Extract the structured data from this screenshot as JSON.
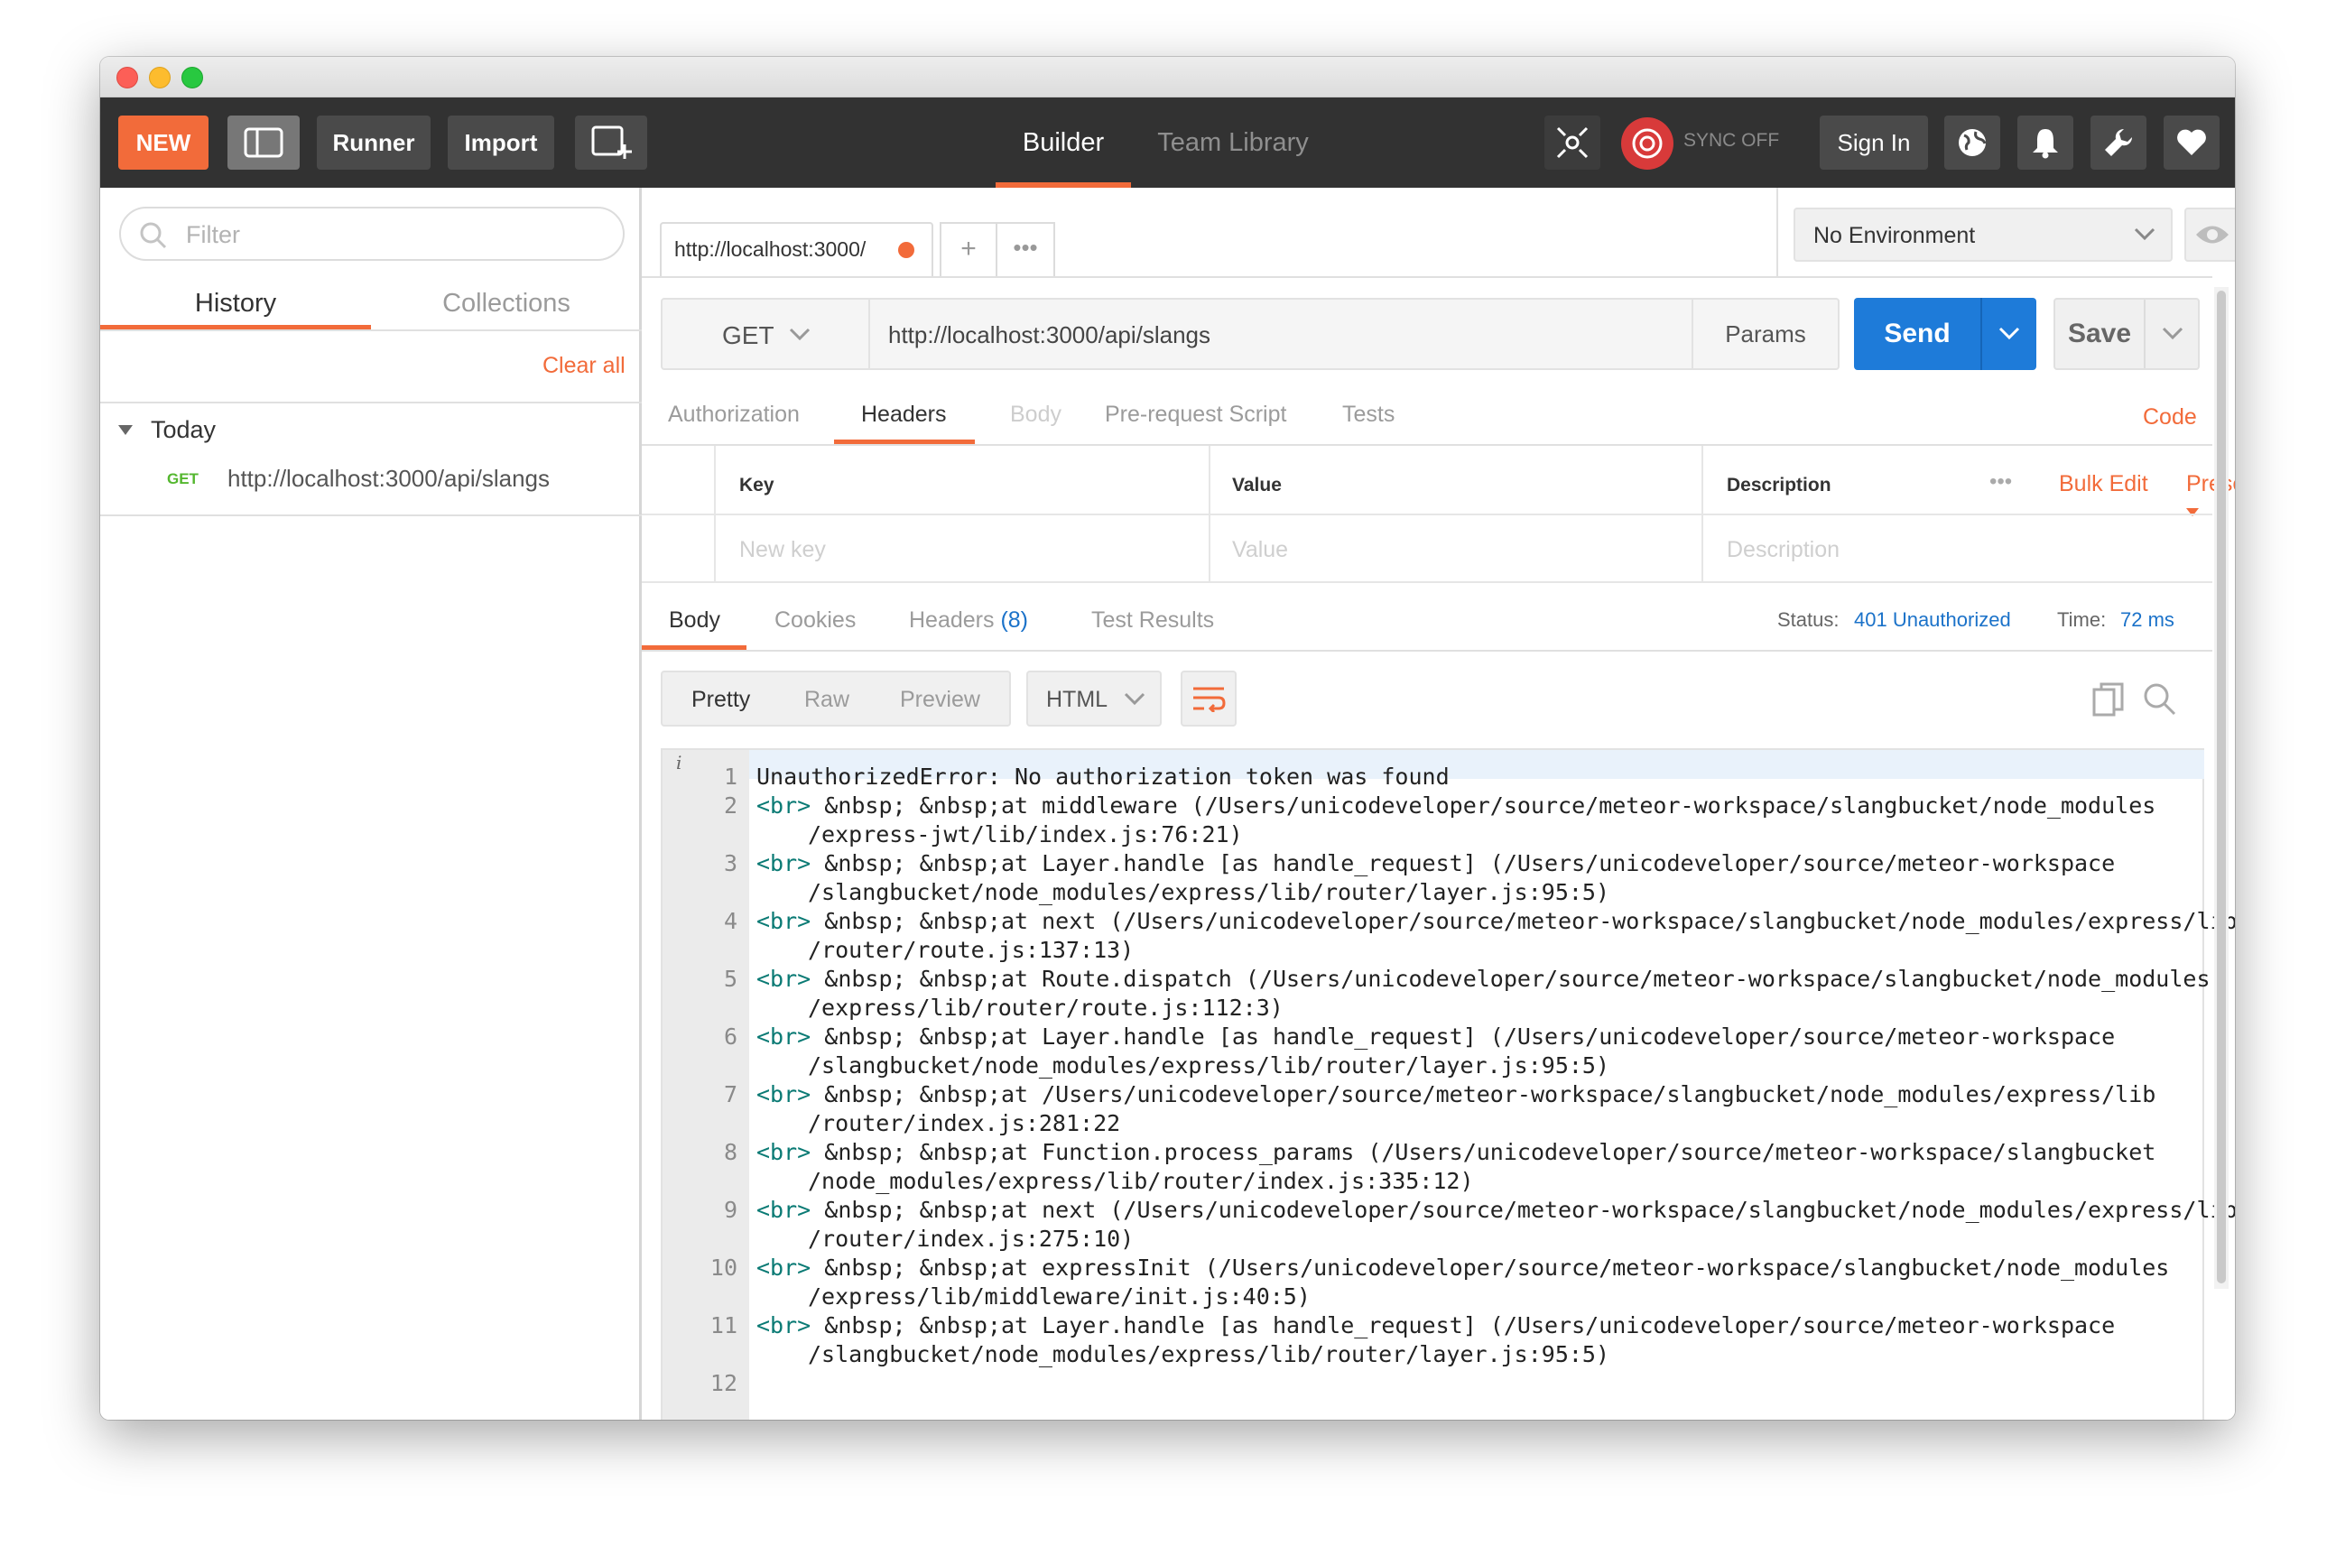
{
  "topbar": {
    "new_label": "NEW",
    "runner_label": "Runner",
    "import_label": "Import",
    "builder_tab": "Builder",
    "team_library_tab": "Team Library",
    "sync_label": "SYNC OFF",
    "signin_label": "Sign In"
  },
  "sidebar": {
    "filter_placeholder": "Filter",
    "tabs": [
      "History",
      "Collections"
    ],
    "clear_all": "Clear all",
    "group": "Today",
    "items": [
      {
        "method": "GET",
        "url": "http://localhost:3000/api/slangs"
      }
    ]
  },
  "request_tab": {
    "url": "http://localhost:3000/"
  },
  "environment": {
    "selected": "No Environment"
  },
  "request": {
    "method": "GET",
    "url": "http://localhost:3000/api/slangs",
    "params_label": "Params",
    "send_label": "Send",
    "save_label": "Save",
    "tabs": [
      "Authorization",
      "Headers",
      "Body",
      "Pre-request Script",
      "Tests"
    ],
    "code_label": "Code"
  },
  "headers_table": {
    "columns": [
      "Key",
      "Value",
      "Description"
    ],
    "bulk_edit": "Bulk Edit",
    "presets": "Presets",
    "placeholders": {
      "key": "New key",
      "value": "Value",
      "description": "Description"
    }
  },
  "response": {
    "tabs": [
      "Body",
      "Cookies",
      "Headers",
      "Test Results"
    ],
    "headers_count": "(8)",
    "status_label": "Status:",
    "status_value": "401 Unauthorized",
    "time_label": "Time:",
    "time_value": "72 ms",
    "view_modes": [
      "Pretty",
      "Raw",
      "Preview"
    ],
    "format": "HTML",
    "lines": [
      {
        "num": "1",
        "text": [
          "UnauthorizedError: No authorization token was found"
        ]
      },
      {
        "num": "2",
        "text": [
          "&nbsp; &nbsp;at middleware (/Users/unicodeveloper/source/meteor-workspace/slangbucket/node_modules",
          "/express-jwt/lib/index.js:76:21)"
        ]
      },
      {
        "num": "3",
        "text": [
          "&nbsp; &nbsp;at Layer.handle [as handle_request] (/Users/unicodeveloper/source/meteor-workspace",
          "/slangbucket/node_modules/express/lib/router/layer.js:95:5)"
        ]
      },
      {
        "num": "4",
        "text": [
          "&nbsp; &nbsp;at next (/Users/unicodeveloper/source/meteor-workspace/slangbucket/node_modules/express/lib",
          "/router/route.js:137:13)"
        ]
      },
      {
        "num": "5",
        "text": [
          "&nbsp; &nbsp;at Route.dispatch (/Users/unicodeveloper/source/meteor-workspace/slangbucket/node_modules",
          "/express/lib/router/route.js:112:3)"
        ]
      },
      {
        "num": "6",
        "text": [
          "&nbsp; &nbsp;at Layer.handle [as handle_request] (/Users/unicodeveloper/source/meteor-workspace",
          "/slangbucket/node_modules/express/lib/router/layer.js:95:5)"
        ]
      },
      {
        "num": "7",
        "text": [
          "&nbsp; &nbsp;at /Users/unicodeveloper/source/meteor-workspace/slangbucket/node_modules/express/lib",
          "/router/index.js:281:22"
        ]
      },
      {
        "num": "8",
        "text": [
          "&nbsp; &nbsp;at Function.process_params (/Users/unicodeveloper/source/meteor-workspace/slangbucket",
          "/node_modules/express/lib/router/index.js:335:12)"
        ]
      },
      {
        "num": "9",
        "text": [
          "&nbsp; &nbsp;at next (/Users/unicodeveloper/source/meteor-workspace/slangbucket/node_modules/express/lib",
          "/router/index.js:275:10)"
        ]
      },
      {
        "num": "10",
        "text": [
          "&nbsp; &nbsp;at expressInit (/Users/unicodeveloper/source/meteor-workspace/slangbucket/node_modules",
          "/express/lib/middleware/init.js:40:5)"
        ]
      },
      {
        "num": "11",
        "text": [
          "&nbsp; &nbsp;at Layer.handle [as handle_request] (/Users/unicodeveloper/source/meteor-workspace",
          "/slangbucket/node_modules/express/lib/router/layer.js:95:5)"
        ]
      },
      {
        "num": "12",
        "text": [
          ""
        ]
      }
    ],
    "br_tag": "<br>"
  },
  "colors": {
    "accent": "#f26b3a",
    "send": "#1e7bd9",
    "link": "#1b72c9"
  }
}
